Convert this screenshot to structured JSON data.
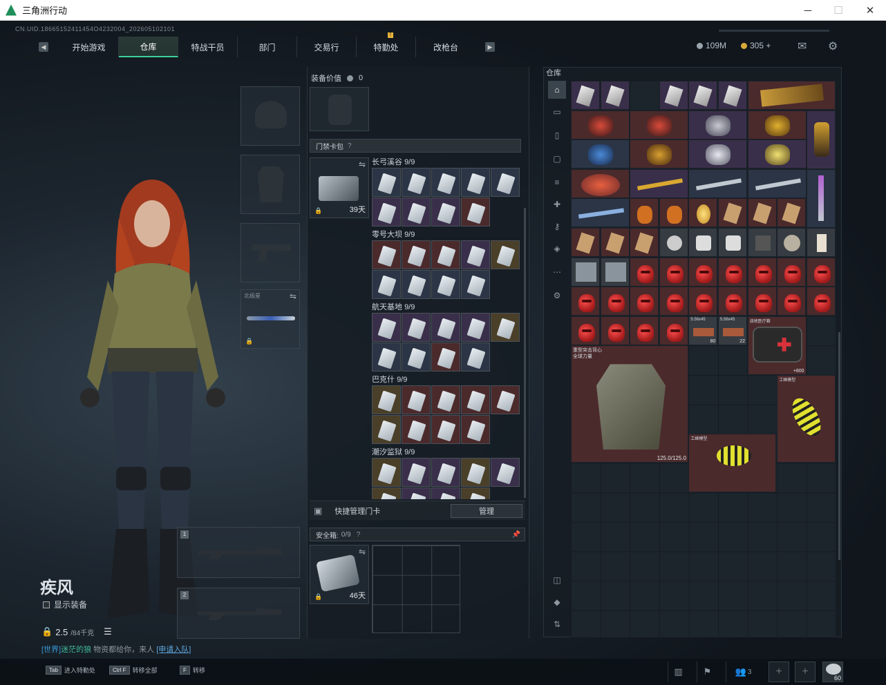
{
  "window": {
    "title": "三角洲行动",
    "minimize": "─",
    "maximize": "☐",
    "close": "✕"
  },
  "header": {
    "uid": "CN.UID.18665152411454O4232004_202605102101",
    "tabs": [
      {
        "label": "开始游戏",
        "active": false
      },
      {
        "label": "仓库",
        "active": true
      },
      {
        "label": "特战干员",
        "active": false
      },
      {
        "label": "部门",
        "active": false
      },
      {
        "label": "交易行",
        "active": false
      },
      {
        "label": "特勤处",
        "active": false
      },
      {
        "label": "改枪台",
        "active": false
      }
    ],
    "notice_badge": "!",
    "prev_icon": "arrow-left-icon",
    "next_icon": "arrow-right-icon",
    "currency": [
      {
        "value": "109M",
        "color": "#9aa4ac"
      },
      {
        "value": "305 +",
        "color": "#d9a83a"
      }
    ],
    "mail_icon": "mail-icon",
    "settings_icon": "gear-icon"
  },
  "character": {
    "name": "疾风",
    "show_equipment": "显示装备",
    "weight": "2.5",
    "weight_max": "/84千克",
    "list_icon": "list-icon"
  },
  "chat": {
    "channel": "[世界]",
    "name": "迷茫的狼",
    "text": " 物资都给你，来人 ",
    "link": "[申请入队]"
  },
  "equip_slots": [
    {
      "label": "",
      "type": "helmet"
    },
    {
      "label": "",
      "type": "armor"
    },
    {
      "label": "",
      "type": "pistol"
    },
    {
      "label": "北极星",
      "type": "melee"
    }
  ],
  "weapon_slots": [
    {
      "index": "1"
    },
    {
      "index": "2"
    }
  ],
  "middle": {
    "equip_value_label": "装备价值",
    "equip_value": "0",
    "keycard_pack_label": "门禁卡包",
    "keycard_days": "39天",
    "groups": [
      {
        "name": "长弓溪谷",
        "count": "9/9"
      },
      {
        "name": "零号大坝",
        "count": "9/9"
      },
      {
        "name": "航天基地",
        "count": "9/9"
      },
      {
        "name": "巴克什",
        "count": "9/9"
      },
      {
        "name": "潮汐监狱",
        "count": "9/9"
      }
    ],
    "manage_label": "快捷管理门卡",
    "manage_button": "管理",
    "safebox_label": "安全箱:",
    "safebox_count": "0/9",
    "safebox_days": "46天"
  },
  "warehouse": {
    "title": "仓库",
    "sidebar_items": [
      "warehouse-icon",
      "gun-icon",
      "armor-icon",
      "bag-icon",
      "ammo-icon",
      "medical-icon",
      "key-icon",
      "collectible-icon",
      "misc-icon",
      "gear-icon",
      "portrait-icon",
      "stack-icon",
      "sort-icon"
    ],
    "armor_name": "重型突击背心",
    "armor_sub": "全球力量",
    "armor_durability": "125.0/125.0",
    "medkit_count": "+800",
    "bee_label": "工蜂模型",
    "ammo1_label": "5.56x45",
    "ammo1_count": "80",
    "ammo2_label": "5.56x45",
    "ammo2_count": "22",
    "med_label": "战地医疗箱"
  },
  "bottom": {
    "keys": [
      {
        "key": "Tab",
        "label": "进入特勤处"
      },
      {
        "key": "Ctrl F",
        "label": "转移全部"
      },
      {
        "key": "F",
        "label": "转移"
      }
    ],
    "squad_count": "3",
    "level": "60"
  }
}
